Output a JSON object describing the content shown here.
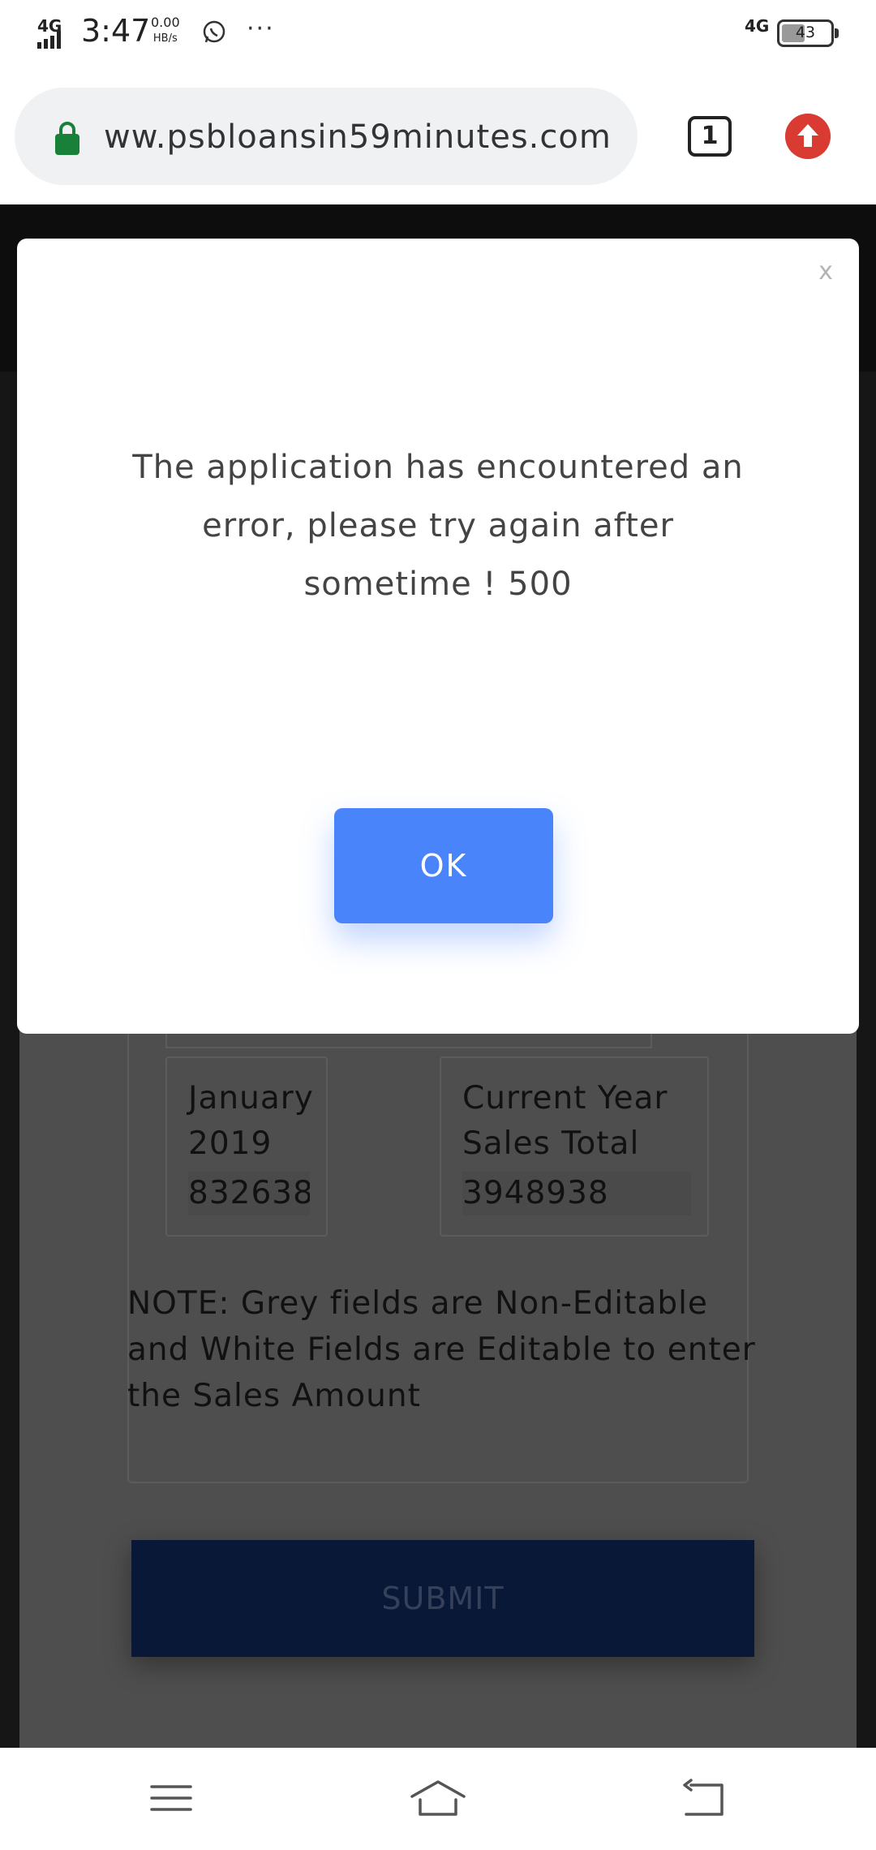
{
  "status_bar": {
    "network_left": "4G",
    "time": "3:47",
    "speed_value": "0.00",
    "speed_unit": "HB/s",
    "more": "···",
    "network_right": "4G",
    "battery": "43",
    "battery_fraction": 0.43
  },
  "browser": {
    "url": "ww.psbloansin59minutes.com",
    "tab_count": "1"
  },
  "page": {
    "cells": [
      {
        "label_line1": "January",
        "label_line2": "2019",
        "value": "832638"
      },
      {
        "label_line1": "Current Year",
        "label_line2": "Sales Total",
        "value": "3948938"
      }
    ],
    "note": "NOTE: Grey fields are Non-Editable and White Fields are Editable to enter the Sales Amount",
    "submit_label": "SUBMIT"
  },
  "modal": {
    "message_line1": "The application has encountered an",
    "message_line2": "error, please try again after",
    "message_line3": "sometime ! 500",
    "ok_label": "OK",
    "close_label": "x"
  },
  "colors": {
    "ok_button": "#4a84fb",
    "submit_button": "#0a1838",
    "lock": "#188038",
    "update_button": "#d93a32"
  }
}
